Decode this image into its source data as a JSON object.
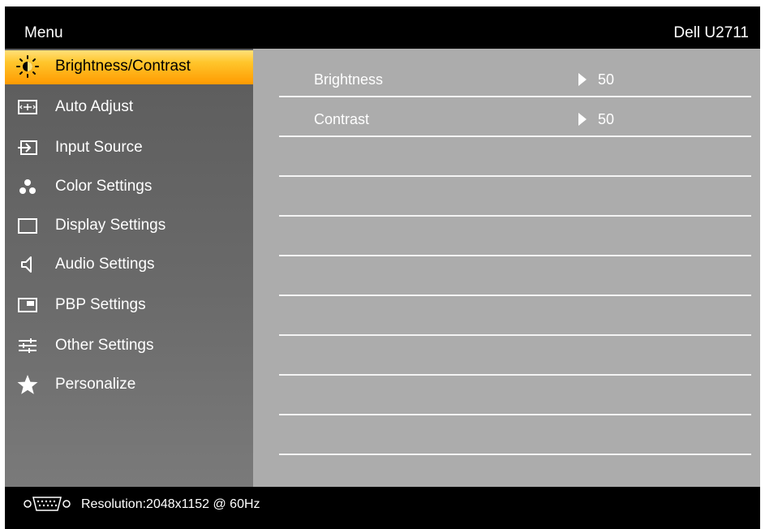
{
  "header": {
    "title": "Menu",
    "model": "Dell U2711"
  },
  "sidebar": {
    "items": [
      {
        "label": "Brightness/Contrast",
        "icon": "brightness-icon",
        "active": true
      },
      {
        "label": "Auto Adjust",
        "icon": "auto-adjust-icon"
      },
      {
        "label": "Input Source",
        "icon": "input-source-icon"
      },
      {
        "label": "Color Settings",
        "icon": "color-settings-icon"
      },
      {
        "label": "Display Settings",
        "icon": "display-settings-icon"
      },
      {
        "label": "Audio Settings",
        "icon": "speaker-icon"
      },
      {
        "label": "PBP Settings",
        "icon": "pbp-icon"
      },
      {
        "label": "Other Settings",
        "icon": "sliders-icon"
      },
      {
        "label": "Personalize",
        "icon": "star-icon"
      }
    ]
  },
  "content": {
    "rows": [
      {
        "label": "Brightness",
        "value": "50"
      },
      {
        "label": "Contrast",
        "value": "50"
      },
      {
        "label": "",
        "value": ""
      },
      {
        "label": "",
        "value": ""
      },
      {
        "label": "",
        "value": ""
      },
      {
        "label": "",
        "value": ""
      },
      {
        "label": "",
        "value": ""
      },
      {
        "label": "",
        "value": ""
      },
      {
        "label": "",
        "value": ""
      },
      {
        "label": "",
        "value": ""
      }
    ]
  },
  "footer": {
    "icon": "vga-connector-icon",
    "resolution": "Resolution:2048x1152 @ 60Hz"
  },
  "colors": {
    "active_top": "#ffe07a",
    "active_bottom": "#ff9a00",
    "content_bg": "#acacac",
    "sidebar_bg": "#666666"
  }
}
